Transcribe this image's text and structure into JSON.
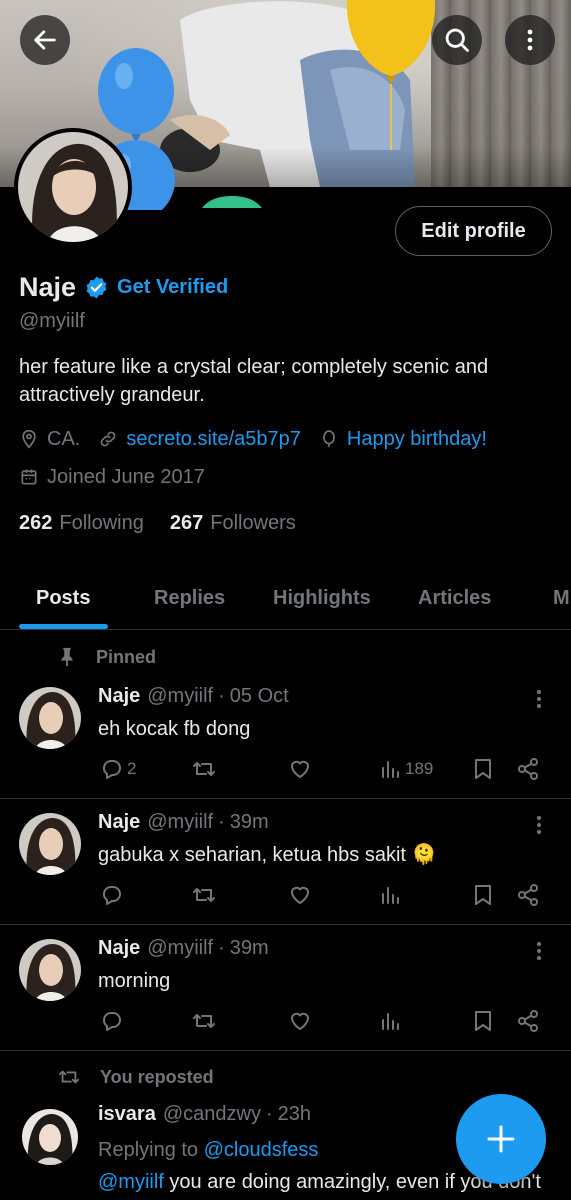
{
  "profile": {
    "display_name": "Naje",
    "get_verified": "Get Verified",
    "handle": "@myiilf",
    "bio": "her feature like a crystal clear; completely scenic and attractively grandeur.",
    "location": "CA.",
    "link": "secreto.site/a5b7p7",
    "birthday": "Happy birthday!",
    "joined": "Joined June 2017",
    "following_count": "262",
    "following_label": "Following",
    "followers_count": "267",
    "followers_label": "Followers",
    "edit_profile": "Edit profile"
  },
  "tabs": [
    "Posts",
    "Replies",
    "Highlights",
    "Articles",
    "M"
  ],
  "pinned_label": "Pinned",
  "reposted_label": "You reposted",
  "posts": [
    {
      "name": "Naje",
      "handle": "@myiilf",
      "time": "05 Oct",
      "text": "eh kocak fb dong",
      "replies": "2",
      "views": "189"
    },
    {
      "name": "Naje",
      "handle": "@myiilf",
      "time": "39m",
      "text": "gabuka x seharian, ketua hbs sakit 🫠"
    },
    {
      "name": "Naje",
      "handle": "@myiilf",
      "time": "39m",
      "text": "morning"
    },
    {
      "name": "isvara",
      "handle": "@candzwy",
      "time": "23h",
      "replying_prefix": "Replying to",
      "replying_to": "@cloudsfess",
      "mention": "@myiilf",
      "text": "you are doing amazingly, even if you don't"
    }
  ],
  "colors": {
    "accent": "#1d9bf0",
    "background": "#000000",
    "muted": "#71767b",
    "text": "#e7e9ea",
    "divider": "#2f3336"
  }
}
